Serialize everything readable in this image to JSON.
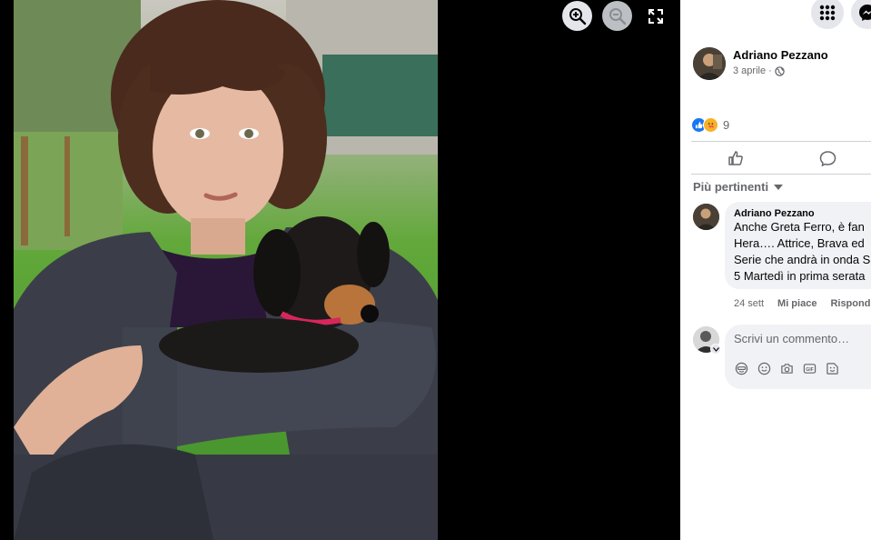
{
  "viewer": {
    "zoom_in_icon": "zoom-in-icon",
    "zoom_out_icon": "zoom-out-icon",
    "fullscreen_icon": "fullscreen-icon",
    "photo_subject": "woman-holding-dachshund-photo"
  },
  "topbar": {
    "menu_icon": "grid-menu-icon",
    "messenger_icon": "messenger-icon"
  },
  "post": {
    "author": "Adriano Pezzano",
    "date": "3 aprile",
    "separator": "·",
    "audience_icon": "globe-icon",
    "reaction_count": "9"
  },
  "comments": {
    "sort_label": "Più pertinenti",
    "items": [
      {
        "author": "Adriano Pezzano",
        "lines": [
          "Anche Greta Ferro, è fan",
          "Hera…. Attrice, Brava ed",
          "Serie che andrà in onda S",
          "5 Martedì in prima serata"
        ],
        "time": "24 sett",
        "like_label": "Mi piace",
        "reply_label": "Rispondi"
      }
    ],
    "composer_placeholder": "Scrivi un commento…"
  },
  "colors": {
    "accent": "#1877f2",
    "care": "#f7b125",
    "panel_bg": "#ffffff",
    "bubble_bg": "#f0f2f5",
    "secondary_text": "#65676b"
  }
}
